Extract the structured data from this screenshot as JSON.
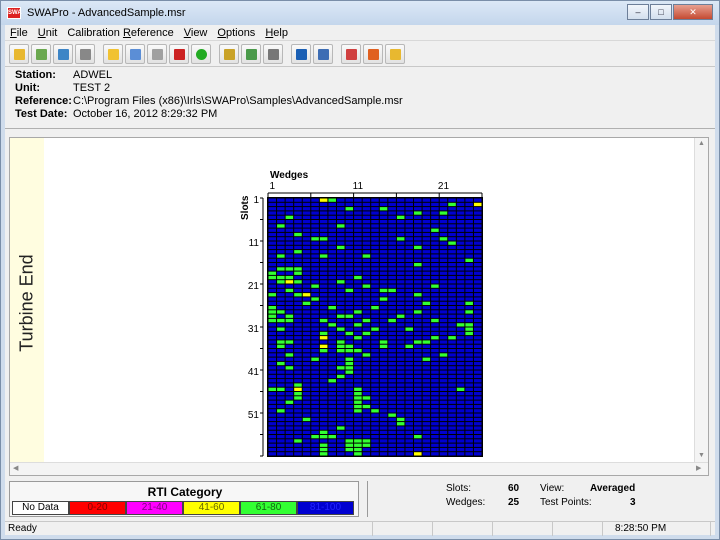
{
  "window": {
    "title": "SWAPro - AdvancedSample.msr",
    "icon_text": "SWA"
  },
  "menu": [
    {
      "key": "F",
      "rest": "ile"
    },
    {
      "key": "U",
      "rest": "nit"
    },
    {
      "key": "",
      "rest": "Calibration ",
      "key2": "R",
      "rest2": "eference"
    },
    {
      "key": "V",
      "rest": "iew"
    },
    {
      "key": "O",
      "rest": "ptions"
    },
    {
      "key": "H",
      "rest": "elp"
    }
  ],
  "toolbar_icons": [
    {
      "name": "open-folder-icon",
      "color": "#e8b830",
      "group": 0
    },
    {
      "name": "grid-add-icon",
      "color": "#6aa84f",
      "group": 0
    },
    {
      "name": "window-icon",
      "color": "#3d85c6",
      "group": 0
    },
    {
      "name": "print-icon",
      "color": "#888888",
      "group": 0
    },
    {
      "name": "document-new-icon",
      "color": "#f1c232",
      "group": 1
    },
    {
      "name": "document-icon",
      "color": "#5b8ed6",
      "group": 1
    },
    {
      "name": "edit-icon",
      "color": "#a0a0a0",
      "group": 1
    },
    {
      "name": "delete-icon",
      "color": "#cc2222",
      "group": 1
    },
    {
      "name": "record-icon",
      "color": "#22aa22",
      "group": 1
    },
    {
      "name": "key-icon",
      "color": "#c9a227",
      "group": 2
    },
    {
      "name": "meter-icon",
      "color": "#4a9a4a",
      "group": 2
    },
    {
      "name": "tools-icon",
      "color": "#777777",
      "group": 2
    },
    {
      "name": "move-icon",
      "color": "#1a5fb4",
      "group": 3
    },
    {
      "name": "table-icon",
      "color": "#3d6db4",
      "group": 3
    },
    {
      "name": "export-icon",
      "color": "#d04040",
      "group": 4
    },
    {
      "name": "refresh-icon",
      "color": "#e06020",
      "group": 4
    },
    {
      "name": "folder-icon",
      "color": "#e8b830",
      "group": 4
    }
  ],
  "info": {
    "station_label": "Station:",
    "station": "ADWEL",
    "unit_label": "Unit:",
    "unit": "TEST 2",
    "reference_label": "Reference:",
    "reference": "C:\\Program Files (x86)\\Irls\\SWAPro\\Samples\\AdvancedSample.msr",
    "test_date_label": "Test Date:",
    "test_date": "October 16, 2012  8:29:32 PM"
  },
  "side_label": "Turbine End",
  "chart_data": {
    "type": "heatmap",
    "title": "",
    "xlabel": "Wedges",
    "ylabel": "Slots",
    "x_ticks": [
      "1",
      "11",
      "21"
    ],
    "y_ticks": [
      "1",
      "11",
      "21",
      "31",
      "41",
      "51"
    ],
    "rows": 60,
    "cols": 25,
    "colors": {
      "none": "#ffffff",
      "c0_20": "#ff0000",
      "c21_40": "#ff00ff",
      "c41_60": "#ffff00",
      "c61_80": "#33ff33",
      "c81_100": "#0000d0"
    },
    "default_category": "81-100",
    "cells_61_80": [
      [
        1,
        8
      ],
      [
        2,
        22
      ],
      [
        3,
        10
      ],
      [
        3,
        14
      ],
      [
        4,
        18
      ],
      [
        4,
        21
      ],
      [
        5,
        3
      ],
      [
        5,
        16
      ],
      [
        7,
        2
      ],
      [
        7,
        9
      ],
      [
        8,
        20
      ],
      [
        9,
        4
      ],
      [
        10,
        6
      ],
      [
        10,
        7
      ],
      [
        10,
        16
      ],
      [
        10,
        21
      ],
      [
        11,
        22
      ],
      [
        12,
        9
      ],
      [
        12,
        18
      ],
      [
        13,
        4
      ],
      [
        14,
        2
      ],
      [
        14,
        7
      ],
      [
        14,
        12
      ],
      [
        15,
        24
      ],
      [
        16,
        18
      ],
      [
        17,
        2
      ],
      [
        17,
        3
      ],
      [
        17,
        4
      ],
      [
        18,
        1
      ],
      [
        18,
        4
      ],
      [
        19,
        1
      ],
      [
        19,
        2
      ],
      [
        19,
        3
      ],
      [
        19,
        11
      ],
      [
        20,
        2
      ],
      [
        20,
        3
      ],
      [
        20,
        4
      ],
      [
        20,
        9
      ],
      [
        21,
        6
      ],
      [
        21,
        12
      ],
      [
        21,
        20
      ],
      [
        22,
        3
      ],
      [
        22,
        10
      ],
      [
        22,
        14
      ],
      [
        22,
        15
      ],
      [
        23,
        1
      ],
      [
        23,
        4
      ],
      [
        23,
        18
      ],
      [
        24,
        6
      ],
      [
        24,
        14
      ],
      [
        25,
        5
      ],
      [
        25,
        19
      ],
      [
        25,
        24
      ],
      [
        26,
        1
      ],
      [
        26,
        8
      ],
      [
        26,
        13
      ],
      [
        27,
        1
      ],
      [
        27,
        2
      ],
      [
        27,
        11
      ],
      [
        27,
        18
      ],
      [
        27,
        24
      ],
      [
        28,
        1
      ],
      [
        28,
        3
      ],
      [
        28,
        9
      ],
      [
        28,
        10
      ],
      [
        28,
        16
      ],
      [
        29,
        1
      ],
      [
        29,
        2
      ],
      [
        29,
        3
      ],
      [
        29,
        7
      ],
      [
        29,
        12
      ],
      [
        29,
        15
      ],
      [
        29,
        20
      ],
      [
        30,
        8
      ],
      [
        30,
        11
      ],
      [
        30,
        23
      ],
      [
        30,
        24
      ],
      [
        31,
        2
      ],
      [
        31,
        9
      ],
      [
        31,
        13
      ],
      [
        31,
        17
      ],
      [
        31,
        24
      ],
      [
        32,
        7
      ],
      [
        32,
        10
      ],
      [
        32,
        12
      ],
      [
        32,
        24
      ],
      [
        33,
        7
      ],
      [
        33,
        11
      ],
      [
        33,
        20
      ],
      [
        33,
        22
      ],
      [
        34,
        2
      ],
      [
        34,
        3
      ],
      [
        34,
        9
      ],
      [
        34,
        14
      ],
      [
        34,
        18
      ],
      [
        34,
        19
      ],
      [
        35,
        2
      ],
      [
        35,
        7
      ],
      [
        35,
        9
      ],
      [
        35,
        10
      ],
      [
        35,
        14
      ],
      [
        35,
        17
      ],
      [
        36,
        7
      ],
      [
        36,
        9
      ],
      [
        36,
        10
      ],
      [
        36,
        11
      ],
      [
        37,
        3
      ],
      [
        37,
        12
      ],
      [
        37,
        21
      ],
      [
        38,
        6
      ],
      [
        38,
        10
      ],
      [
        38,
        19
      ],
      [
        39,
        2
      ],
      [
        39,
        10
      ],
      [
        40,
        3
      ],
      [
        40,
        9
      ],
      [
        40,
        10
      ],
      [
        41,
        10
      ],
      [
        42,
        9
      ],
      [
        43,
        8
      ],
      [
        44,
        4
      ],
      [
        45,
        1
      ],
      [
        45,
        2
      ],
      [
        45,
        11
      ],
      [
        45,
        23
      ],
      [
        46,
        4
      ],
      [
        46,
        11
      ],
      [
        47,
        4
      ],
      [
        47,
        11
      ],
      [
        47,
        12
      ],
      [
        48,
        3
      ],
      [
        48,
        11
      ],
      [
        49,
        11
      ],
      [
        49,
        12
      ],
      [
        50,
        2
      ],
      [
        50,
        11
      ],
      [
        50,
        13
      ],
      [
        51,
        15
      ],
      [
        52,
        5
      ],
      [
        52,
        16
      ],
      [
        53,
        16
      ],
      [
        54,
        9
      ],
      [
        55,
        7
      ],
      [
        56,
        6
      ],
      [
        56,
        7
      ],
      [
        56,
        8
      ],
      [
        56,
        18
      ],
      [
        57,
        4
      ],
      [
        57,
        10
      ],
      [
        57,
        11
      ],
      [
        57,
        12
      ],
      [
        58,
        7
      ],
      [
        58,
        10
      ],
      [
        58,
        11
      ],
      [
        58,
        12
      ],
      [
        59,
        7
      ],
      [
        59,
        10
      ],
      [
        59,
        11
      ],
      [
        60,
        7
      ],
      [
        60,
        11
      ]
    ],
    "cells_41_60": [
      [
        1,
        7
      ],
      [
        2,
        25
      ],
      [
        20,
        3
      ],
      [
        23,
        5
      ],
      [
        33,
        7
      ],
      [
        35,
        7
      ],
      [
        45,
        4
      ],
      [
        60,
        18
      ]
    ]
  },
  "legend": {
    "title": "RTI Category",
    "cells": [
      {
        "label": "No Data",
        "bg": "#ffffff",
        "fg": "#000000"
      },
      {
        "label": "0-20",
        "bg": "#ff0000",
        "fg": "#800000"
      },
      {
        "label": "21-40",
        "bg": "#ff00ff",
        "fg": "#800080"
      },
      {
        "label": "41-60",
        "bg": "#ffff00",
        "fg": "#666600"
      },
      {
        "label": "61-80",
        "bg": "#33ff33",
        "fg": "#116611"
      },
      {
        "label": "81-100",
        "bg": "#0000d0",
        "fg": "#2222ff"
      }
    ]
  },
  "stats": {
    "slots_label": "Slots:",
    "slots": "60",
    "wedges_label": "Wedges:",
    "wedges": "25",
    "view_label": "View:",
    "view": "Averaged",
    "tp_label": "Test Points:",
    "tp": "3"
  },
  "status": {
    "text": "Ready",
    "time": "8:28:50 PM"
  }
}
